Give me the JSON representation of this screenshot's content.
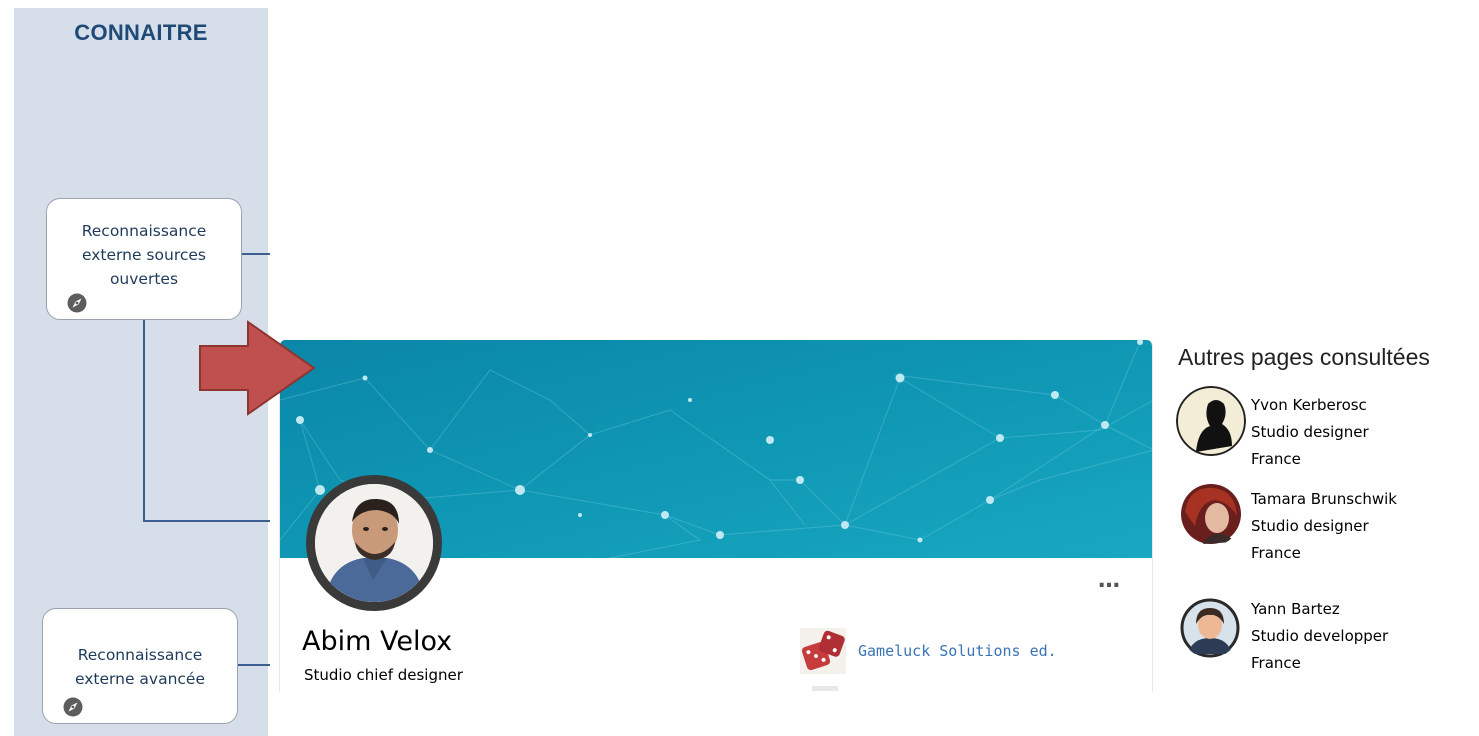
{
  "diagram": {
    "column_title": "CONNAITRE",
    "nodes": [
      {
        "label_lines": [
          "Reconnaissance",
          "externe sources",
          "ouvertes"
        ]
      },
      {
        "label_lines": [
          "Reconnaissance",
          "externe avancée"
        ]
      }
    ],
    "icon": "compass-icon",
    "colors": {
      "column_bg": "#d6dee9",
      "title": "#1f4a78",
      "connector": "#3b5f8e",
      "arrow": "#c0504d"
    }
  },
  "profile_card": {
    "name": "Abim Velox",
    "title": "Studio chief designer",
    "more_label": "…",
    "company": {
      "name": "Gameluck Solutions ed.",
      "logo_icon": "dice-icon"
    },
    "banner_colors": [
      "#0c8bab",
      "#14a3bd"
    ]
  },
  "sidebar": {
    "heading": "Autres pages consultées",
    "people": [
      {
        "name": "Yvon Kerberosc",
        "role": "Studio designer",
        "country": "France"
      },
      {
        "name": "Tamara Brunschwik",
        "role": "Studio designer",
        "country": "France"
      },
      {
        "name": "Yann Bartez",
        "role": "Studio developper",
        "country": "France"
      }
    ]
  }
}
